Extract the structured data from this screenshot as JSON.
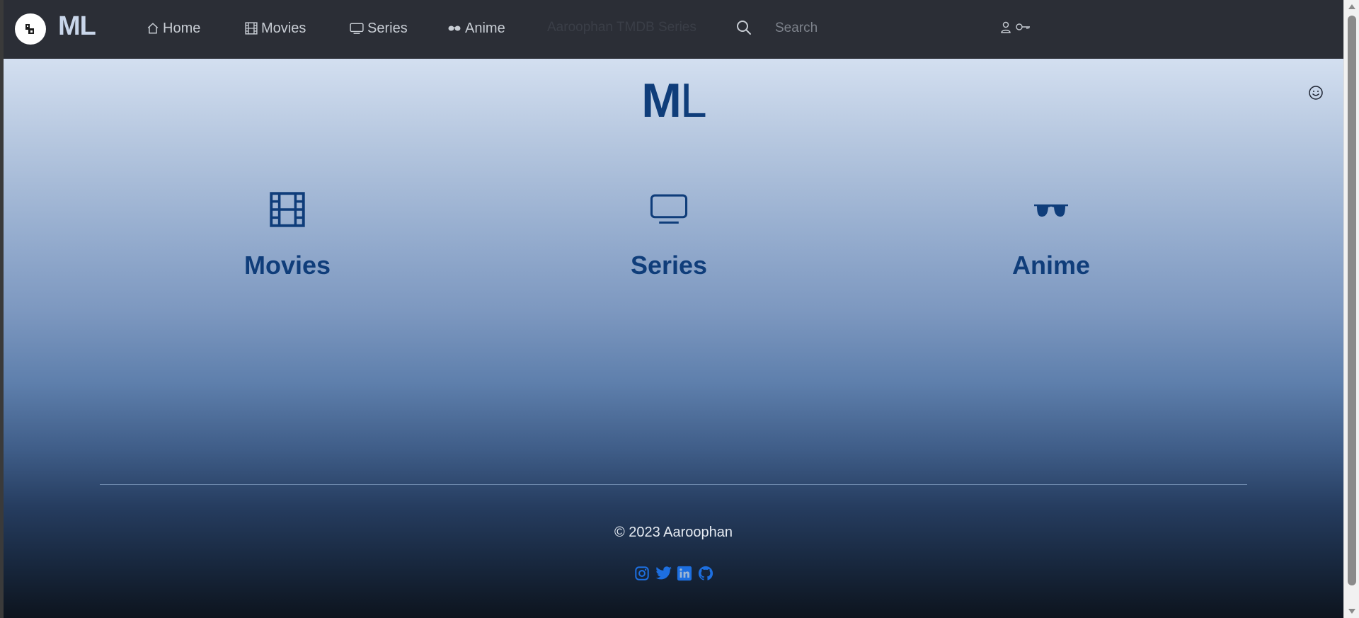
{
  "navbar": {
    "brand": "ML",
    "links": [
      {
        "label": "Home",
        "icon": "home-icon"
      },
      {
        "label": "Movies",
        "icon": "film-icon"
      },
      {
        "label": "Series",
        "icon": "tv-icon"
      },
      {
        "label": "Anime",
        "icon": "sunglasses-icon"
      }
    ],
    "faded_text": "Aaroophan TMDB Series",
    "search": {
      "placeholder": "Search",
      "value": ""
    }
  },
  "hero": {
    "title_bold": "M",
    "title_light": "L",
    "categories": [
      {
        "label": "Movies",
        "icon": "film-icon"
      },
      {
        "label": "Series",
        "icon": "tv-icon"
      },
      {
        "label": "Anime",
        "icon": "sunglasses-icon"
      }
    ]
  },
  "footer": {
    "copyright": "© 2023 Aaroophan",
    "socials": [
      "instagram-icon",
      "twitter-icon",
      "linkedin-icon",
      "github-icon"
    ]
  },
  "colors": {
    "navbar_bg": "#2b2e36",
    "accent": "#0f3d7a",
    "social_blue": "#1d6fe0"
  }
}
